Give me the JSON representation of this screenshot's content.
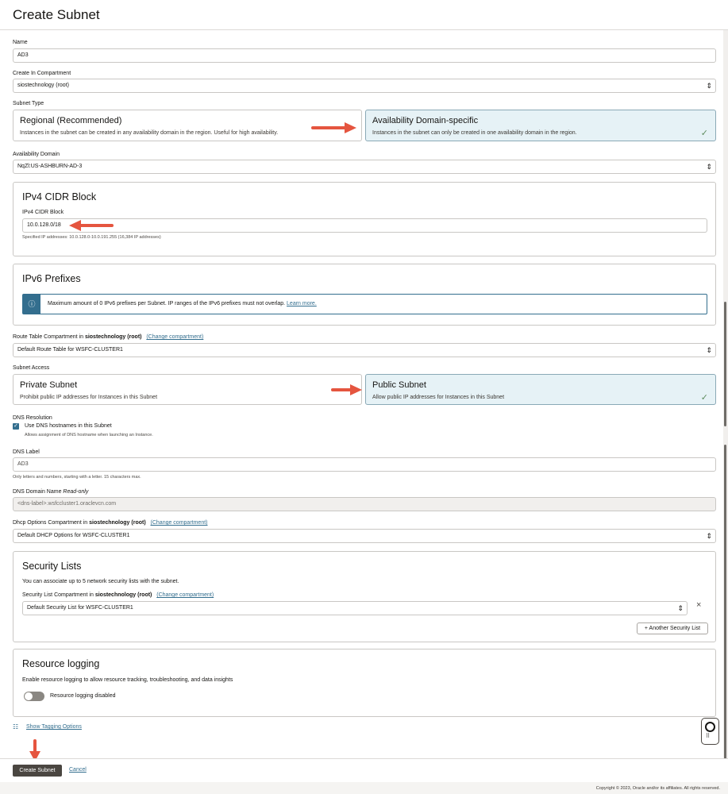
{
  "page_title": "Create Subnet",
  "name": {
    "label": "Name",
    "value": "AD3"
  },
  "compartment": {
    "label": "Create In Compartment",
    "value": "siostechnology (root)"
  },
  "subnet_type": {
    "label": "Subnet Type",
    "regional": {
      "title": "Regional (Recommended)",
      "desc": "Instances in the subnet can be created in any availability domain in the region. Useful for high availability."
    },
    "ad_specific": {
      "title": "Availability Domain-specific",
      "desc": "Instances in the subnet can only be created in one availability domain in the region."
    }
  },
  "availability_domain": {
    "label": "Availability Domain",
    "value": "NqZl:US-ASHBURN-AD-3"
  },
  "ipv4": {
    "title": "IPv4 CIDR Block",
    "label": "IPv4 CIDR Block",
    "value": "10.0.128.0/18",
    "hint": "Specified IP addresses: 10.0.128.0-10.0.191.255 (16,384 IP addresses)"
  },
  "ipv6": {
    "title": "IPv6 Prefixes",
    "info": "Maximum amount of 0 IPv6 prefixes per Subnet. IP ranges of the IPv6 prefixes must not overlap.",
    "learn_more": "Learn more."
  },
  "route_table": {
    "label_prefix": "Route Table Compartment in",
    "compartment": "siostechnology (root)",
    "change_link": "(Change compartment)",
    "value": "Default Route Table for WSFC-CLUSTER1"
  },
  "subnet_access": {
    "label": "Subnet Access",
    "private": {
      "title": "Private Subnet",
      "desc": "Prohibit public IP addresses for Instances in this Subnet"
    },
    "public": {
      "title": "Public Subnet",
      "desc": "Allow public IP addresses for Instances in this Subnet"
    }
  },
  "dns": {
    "resolution_label": "DNS Resolution",
    "checkbox_label": "Use DNS hostnames in this Subnet",
    "checkbox_hint": "Allows assignment of DNS hostname when launching an Instance.",
    "label_label": "DNS Label",
    "label_value": "AD3",
    "label_hint": "Only letters and numbers, starting with a letter. 15 characters max.",
    "domain_label": "DNS Domain Name",
    "domain_readonly": "Read-only",
    "domain_value": "<dns-label>.wsfccluster1.oraclevcn.com"
  },
  "dhcp": {
    "label_prefix": "Dhcp Options Compartment in",
    "compartment": "siostechnology (root)",
    "change_link": "(Change compartment)",
    "value": "Default DHCP Options for WSFC-CLUSTER1"
  },
  "security_lists": {
    "title": "Security Lists",
    "desc": "You can associate up to 5 network security lists with the subnet.",
    "label_prefix": "Security List Compartment in",
    "compartment": "siostechnology (root)",
    "change_link": "(Change compartment)",
    "value": "Default Security List for WSFC-CLUSTER1",
    "add_button": "+ Another Security List"
  },
  "resource_logging": {
    "title": "Resource logging",
    "desc": "Enable resource logging to allow resource tracking, troubleshooting, and data insights",
    "toggle_label": "Resource logging disabled"
  },
  "tagging_link": "Show Tagging Options",
  "footer": {
    "create": "Create Subnet",
    "cancel": "Cancel",
    "copyright": "Copyright © 2023, Oracle and/or its affiliates. All rights reserved."
  },
  "colors": {
    "accent": "#336e8e",
    "selected_card_bg": "#e6f2f6",
    "primary_button": "#4a4641",
    "annotation_arrow": "#e5553f"
  }
}
